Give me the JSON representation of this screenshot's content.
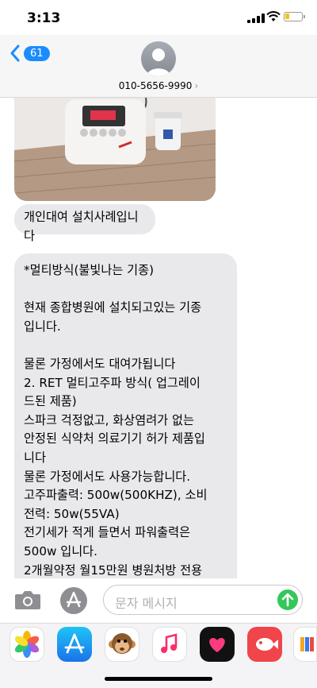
{
  "status": {
    "time": "3:13"
  },
  "header": {
    "back_count": "61",
    "contact": "010-5656-9990",
    "contact_chevron": "›"
  },
  "messages": {
    "msg1": "개인대여 설치사례입니다",
    "msg2_lines": [
      "*멀티방식(불빛나는 기종)",
      "",
      "현재 종합병원에 설치되고있는 기종",
      "입니다.",
      "",
      "물론 가정에서도 대여가됩니다",
      "2. RET 멀티고주파 방식( 업그레이",
      "드된 제품)",
      "스파크 걱정없고, 화상염려가 없는",
      "안정된 식약처 의료기기 허가 제품입",
      "니다",
      "물론 가정에서도 사용가능합니다.",
      "고주파출력: 500w(500KHZ), 소비",
      "전력: 50w(55VA)",
      "전기세가 적게 들면서 파워출력은",
      "500w 입니다.",
      "2개월약정 월15만원  병원처방 전용"
    ]
  },
  "input": {
    "placeholder": "문자 메시지"
  },
  "apps": [
    "photos-app",
    "app-store",
    "animoji",
    "music",
    "digital-touch",
    "app-6",
    "app-7"
  ],
  "colors": {
    "accent": "#1a8cff",
    "bubble": "#e9e9eb",
    "send": "#34c759"
  }
}
